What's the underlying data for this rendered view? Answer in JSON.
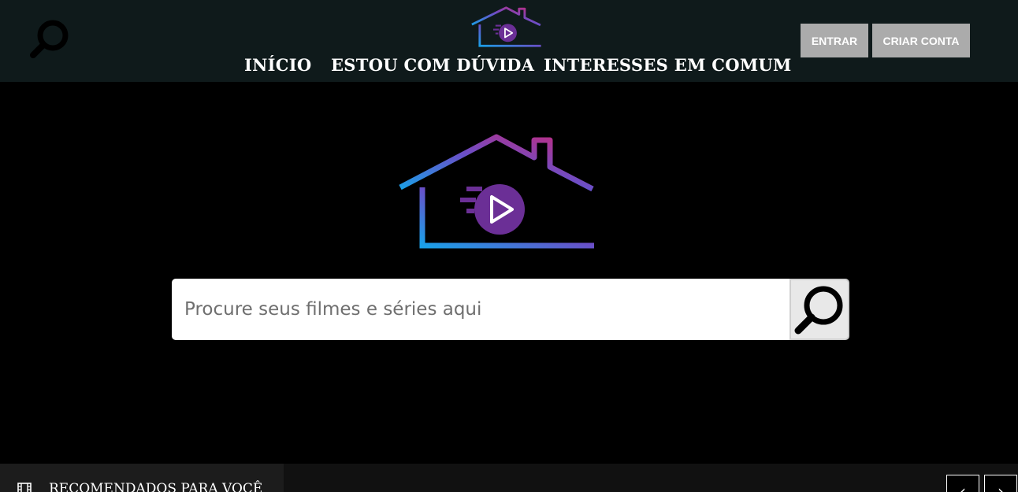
{
  "header": {
    "search_icon": "search-icon",
    "logo_icon": "house-play-logo-icon",
    "nav": [
      {
        "label": "INÍCIO"
      },
      {
        "label": "ESTOU COM DÚVIDA"
      },
      {
        "label": "INTERESSES EM COMUM"
      }
    ],
    "login_label": "ENTRAR",
    "signup_label": "CRIAR CONTA"
  },
  "hero": {
    "logo_icon": "house-play-logo-icon",
    "search": {
      "placeholder": "Procure seus filmes e séries aqui",
      "value": "",
      "button_icon": "search-icon"
    }
  },
  "recommendations": {
    "icon": "film-icon",
    "title": "RECOMENDADOS PARA VOCÊ",
    "prev_label": "‹",
    "next_label": "›"
  },
  "colors": {
    "header_bg": "#0f1a1b",
    "page_bg": "#000000",
    "button_bg": "#ababab",
    "logo_gradient_start": "#1aa0e8",
    "logo_gradient_mid": "#6a4fc8",
    "logo_gradient_end": "#c8287a",
    "play_circle": "#6b2f96"
  }
}
